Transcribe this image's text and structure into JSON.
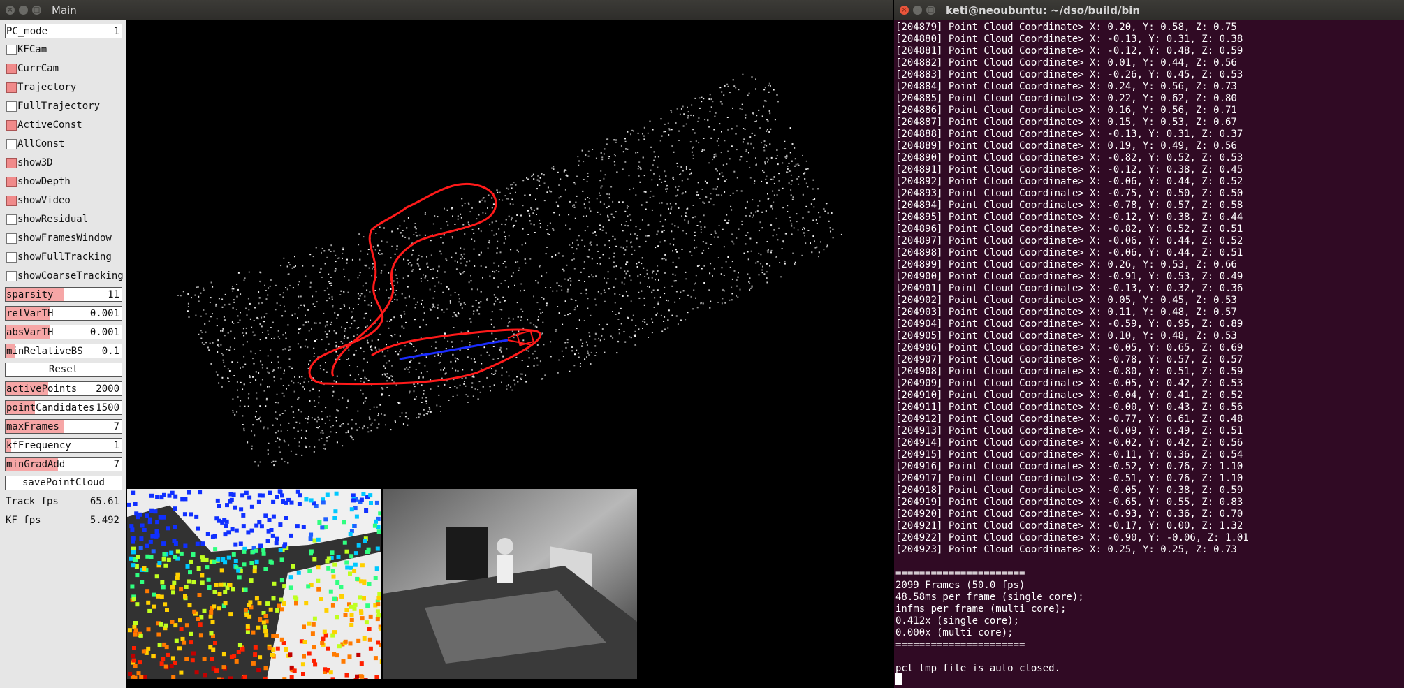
{
  "main_window": {
    "title": "Main",
    "panel": {
      "pc_mode": {
        "label": "PC_mode",
        "value": "1"
      },
      "checkboxes": [
        {
          "label": "KFCam",
          "checked": false
        },
        {
          "label": "CurrCam",
          "checked": true
        },
        {
          "label": "Trajectory",
          "checked": true
        },
        {
          "label": "FullTrajectory",
          "checked": false
        },
        {
          "label": "ActiveConst",
          "checked": true
        },
        {
          "label": "AllConst",
          "checked": false
        },
        {
          "label": "show3D",
          "checked": true
        },
        {
          "label": "showDepth",
          "checked": true
        },
        {
          "label": "showVideo",
          "checked": true
        },
        {
          "label": "showResidual",
          "checked": false
        },
        {
          "label": "showFramesWindow",
          "checked": false
        },
        {
          "label": "showFullTracking",
          "checked": false
        },
        {
          "label": "showCoarseTracking",
          "checked": false
        }
      ],
      "sliders_a": [
        {
          "label": "sparsity",
          "value": "11",
          "level": 0.5
        },
        {
          "label": "relVarTH",
          "value": "0.001",
          "level": 0.38
        },
        {
          "label": "absVarTH",
          "value": "0.001",
          "level": 0.38
        },
        {
          "label": "minRelativeBS",
          "value": "0.1",
          "level": 0.08
        }
      ],
      "reset_label": "Reset",
      "sliders_b": [
        {
          "label": "activePoints",
          "value": "2000",
          "level": 0.37
        },
        {
          "label": "pointCandidates",
          "value": "1500",
          "level": 0.25
        },
        {
          "label": "maxFrames",
          "value": "7",
          "level": 0.5
        },
        {
          "label": "kfFrequency",
          "value": "1",
          "level": 0.05
        },
        {
          "label": "minGradAdd",
          "value": "7",
          "level": 0.45
        }
      ],
      "save_label": "savePointCloud",
      "stats": [
        {
          "label": "Track fps",
          "value": "65.61"
        },
        {
          "label": "KF fps",
          "value": "5.492"
        }
      ]
    }
  },
  "terminal": {
    "title": "keti@neoubuntu: ~/dso/build/bin",
    "lines": [
      "[204879] Point Cloud Coordinate> X: 0.20, Y: 0.58, Z: 0.75",
      "[204880] Point Cloud Coordinate> X: -0.13, Y: 0.31, Z: 0.38",
      "[204881] Point Cloud Coordinate> X: -0.12, Y: 0.48, Z: 0.59",
      "[204882] Point Cloud Coordinate> X: 0.01, Y: 0.44, Z: 0.56",
      "[204883] Point Cloud Coordinate> X: -0.26, Y: 0.45, Z: 0.53",
      "[204884] Point Cloud Coordinate> X: 0.24, Y: 0.56, Z: 0.73",
      "[204885] Point Cloud Coordinate> X: 0.22, Y: 0.62, Z: 0.80",
      "[204886] Point Cloud Coordinate> X: 0.16, Y: 0.56, Z: 0.71",
      "[204887] Point Cloud Coordinate> X: 0.15, Y: 0.53, Z: 0.67",
      "[204888] Point Cloud Coordinate> X: -0.13, Y: 0.31, Z: 0.37",
      "[204889] Point Cloud Coordinate> X: 0.19, Y: 0.49, Z: 0.56",
      "[204890] Point Cloud Coordinate> X: -0.82, Y: 0.52, Z: 0.53",
      "[204891] Point Cloud Coordinate> X: -0.12, Y: 0.38, Z: 0.45",
      "[204892] Point Cloud Coordinate> X: -0.06, Y: 0.44, Z: 0.52",
      "[204893] Point Cloud Coordinate> X: -0.75, Y: 0.50, Z: 0.50",
      "[204894] Point Cloud Coordinate> X: -0.78, Y: 0.57, Z: 0.58",
      "[204895] Point Cloud Coordinate> X: -0.12, Y: 0.38, Z: 0.44",
      "[204896] Point Cloud Coordinate> X: -0.82, Y: 0.52, Z: 0.51",
      "[204897] Point Cloud Coordinate> X: -0.06, Y: 0.44, Z: 0.52",
      "[204898] Point Cloud Coordinate> X: -0.06, Y: 0.44, Z: 0.51",
      "[204899] Point Cloud Coordinate> X: 0.26, Y: 0.53, Z: 0.66",
      "[204900] Point Cloud Coordinate> X: -0.91, Y: 0.53, Z: 0.49",
      "[204901] Point Cloud Coordinate> X: -0.13, Y: 0.32, Z: 0.36",
      "[204902] Point Cloud Coordinate> X: 0.05, Y: 0.45, Z: 0.53",
      "[204903] Point Cloud Coordinate> X: 0.11, Y: 0.48, Z: 0.57",
      "[204904] Point Cloud Coordinate> X: -0.59, Y: 0.95, Z: 0.89",
      "[204905] Point Cloud Coordinate> X: 0.10, Y: 0.48, Z: 0.53",
      "[204906] Point Cloud Coordinate> X: -0.05, Y: 0.65, Z: 0.69",
      "[204907] Point Cloud Coordinate> X: -0.78, Y: 0.57, Z: 0.57",
      "[204908] Point Cloud Coordinate> X: -0.80, Y: 0.51, Z: 0.59",
      "[204909] Point Cloud Coordinate> X: -0.05, Y: 0.42, Z: 0.53",
      "[204910] Point Cloud Coordinate> X: -0.04, Y: 0.41, Z: 0.52",
      "[204911] Point Cloud Coordinate> X: -0.00, Y: 0.43, Z: 0.56",
      "[204912] Point Cloud Coordinate> X: -0.77, Y: 0.61, Z: 0.48",
      "[204913] Point Cloud Coordinate> X: -0.09, Y: 0.49, Z: 0.51",
      "[204914] Point Cloud Coordinate> X: -0.02, Y: 0.42, Z: 0.56",
      "[204915] Point Cloud Coordinate> X: -0.11, Y: 0.36, Z: 0.54",
      "[204916] Point Cloud Coordinate> X: -0.52, Y: 0.76, Z: 1.10",
      "[204917] Point Cloud Coordinate> X: -0.51, Y: 0.76, Z: 1.10",
      "[204918] Point Cloud Coordinate> X: -0.05, Y: 0.38, Z: 0.59",
      "[204919] Point Cloud Coordinate> X: -0.65, Y: 0.55, Z: 0.83",
      "[204920] Point Cloud Coordinate> X: -0.93, Y: 0.36, Z: 0.70",
      "[204921] Point Cloud Coordinate> X: -0.17, Y: 0.00, Z: 1.32",
      "[204922] Point Cloud Coordinate> X: -0.90, Y: -0.06, Z: 1.01",
      "[204923] Point Cloud Coordinate> X: 0.25, Y: 0.25, Z: 0.73",
      "",
      "======================",
      "2099 Frames (50.0 fps)",
      "48.58ms per frame (single core);",
      "infms per frame (multi core);",
      "0.412x (single core);",
      "0.000x (multi core);",
      "======================",
      "",
      "pcl tmp file is auto closed."
    ]
  },
  "colors": {
    "trajectory": "#ff1a1a",
    "current_path": "#1a2cff",
    "terminal_bg": "#300a24",
    "panel_bg": "#e6e6e6",
    "checkbox_on": "#f08a8a"
  }
}
